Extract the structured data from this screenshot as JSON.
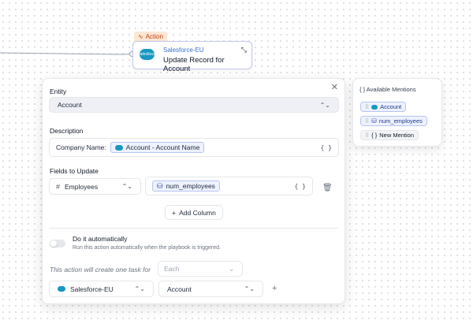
{
  "node": {
    "tag": "Action",
    "integration": "Salesforce-EU",
    "title": "Update Record for Account",
    "logo_text": "salesforce"
  },
  "panel": {
    "entity_label": "Entity",
    "entity_value": "Account",
    "description_label": "Description",
    "description_prefix": "Company Name:",
    "description_chip": "Account - Account Name",
    "fields_label": "Fields to Update",
    "field_name": "Employees",
    "field_value_chip": "num_employees",
    "braces": "{ }",
    "add_column": "Add Column",
    "auto_title": "Do it automatically",
    "auto_desc": "Run this action automatically when the playbook is triggered.",
    "task_note": "This action will create one task for",
    "each_placeholder": "Each",
    "integration_select": "Salesforce-EU",
    "object_select": "Account"
  },
  "mentions": {
    "header": "Available Mentions",
    "items": [
      {
        "label": "Account",
        "icon": "salesforce-icon",
        "style": "blue"
      },
      {
        "label": "num_employees",
        "icon": "database-icon",
        "style": "blue"
      },
      {
        "label": "New Mention",
        "icon": "braces-icon",
        "style": "grey"
      }
    ]
  },
  "colors": {
    "accent": "#3b6fd4",
    "salesforce": "#1798c1",
    "action_tag": "#c2410c"
  }
}
